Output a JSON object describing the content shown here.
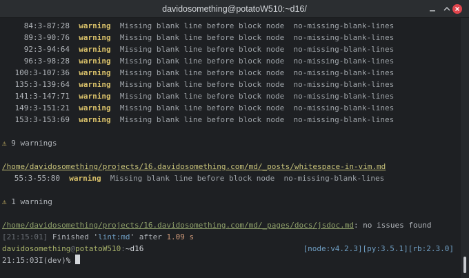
{
  "window": {
    "title": "davidosomething@potatoW510:~d16/"
  },
  "icons": {
    "minimize": "minimize-icon",
    "maximize": "maximize-icon",
    "close": "close-icon",
    "warning": "warning-triangle-icon"
  },
  "colors": {
    "warning": "#d9c16a",
    "close_button": "#e0454d",
    "background": "#1e2023",
    "titlebar": "#2b2e31"
  },
  "terminal": {
    "block1": [
      {
        "pos": "84:3-87:28",
        "level": "warning",
        "message": "Missing blank line before block node",
        "rule": "no-missing-blank-lines"
      },
      {
        "pos": "89:3-90:76",
        "level": "warning",
        "message": "Missing blank line before block node",
        "rule": "no-missing-blank-lines"
      },
      {
        "pos": "92:3-94:64",
        "level": "warning",
        "message": "Missing blank line before block node",
        "rule": "no-missing-blank-lines"
      },
      {
        "pos": "96:3-98:28",
        "level": "warning",
        "message": "Missing blank line before block node",
        "rule": "no-missing-blank-lines"
      },
      {
        "pos": "100:3-107:36",
        "level": "warning",
        "message": "Missing blank line before block node",
        "rule": "no-missing-blank-lines"
      },
      {
        "pos": "135:3-139:64",
        "level": "warning",
        "message": "Missing blank line before block node",
        "rule": "no-missing-blank-lines"
      },
      {
        "pos": "141:3-147:71",
        "level": "warning",
        "message": "Missing blank line before block node",
        "rule": "no-missing-blank-lines"
      },
      {
        "pos": "149:3-151:21",
        "level": "warning",
        "message": "Missing blank line before block node",
        "rule": "no-missing-blank-lines"
      },
      {
        "pos": "153:3-153:69",
        "level": "warning",
        "message": "Missing blank line before block node",
        "rule": "no-missing-blank-lines"
      }
    ],
    "summary1": {
      "symbol": "⚠",
      "text": "9 warnings"
    },
    "file2": "/home/davidosomething/projects/16.davidosomething.com/md/_posts/whitespace-in-vim.md",
    "block2": [
      {
        "pos": "55:3-55:80",
        "level": "warning",
        "message": "Missing blank line before block node",
        "rule": "no-missing-blank-lines"
      }
    ],
    "summary2": {
      "symbol": "⚠",
      "text": "1 warning"
    },
    "file3": {
      "path": "/home/davidosomething/projects/16.davidosomething.com/md/_pages/docs/jsdoc.md",
      "suffix": ": no issues found"
    },
    "finished": {
      "time": "[21:15:01]",
      "pre": " Finished '",
      "task": "lint:md",
      "mid": "' after ",
      "duration": "1.09 s"
    },
    "prompt": {
      "user": "davidosomething",
      "at": "@",
      "host": "potatoW510",
      "sep": ":",
      "dir": "~d16",
      "versions": "[node:v4.2.3][py:3.5.1][rb:2.3.0]"
    },
    "input_line": {
      "time": "21:15:03",
      "mode": "I(dev)",
      "symbol": "%"
    }
  }
}
